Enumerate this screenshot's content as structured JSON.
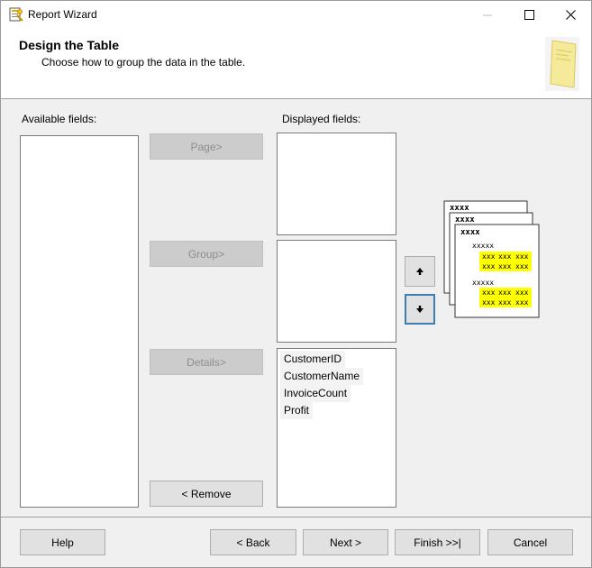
{
  "window": {
    "title": "Report Wizard"
  },
  "header": {
    "title": "Design the Table",
    "subtitle": "Choose how to group the data in the table."
  },
  "labels": {
    "available": "Available fields:",
    "displayed": "Displayed fields:"
  },
  "buttons": {
    "page": "Page>",
    "group": "Group>",
    "details": "Details>",
    "remove": "< Remove",
    "up": "▲",
    "down": "▼"
  },
  "details_fields": [
    "CustomerID",
    "CustomerName",
    "InvoiceCount",
    "Profit"
  ],
  "preview": {
    "header_text": "xxxx",
    "group_text": "xxxxx",
    "cell_text": "xxx"
  },
  "footer": {
    "help": "Help",
    "back": "< Back",
    "next": "Next >",
    "finish": "Finish >>|",
    "cancel": "Cancel"
  },
  "colors": {
    "highlight": "#ffff00",
    "focus": "#3c7fb1"
  }
}
